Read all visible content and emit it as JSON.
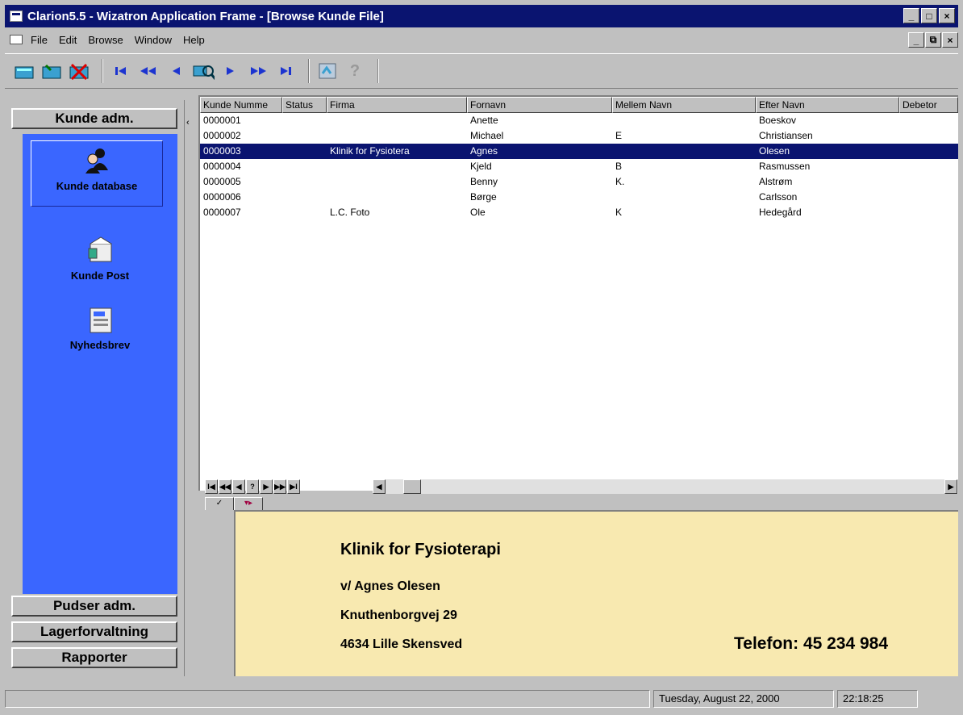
{
  "window": {
    "title": "Clarion5.5 - Wizatron Application Frame - [Browse Kunde File]",
    "controls": [
      "_",
      "□",
      "×"
    ],
    "mdi_controls": [
      "_",
      "⧉",
      "×"
    ]
  },
  "menu": {
    "items": [
      "File",
      "Edit",
      "Browse",
      "Window",
      "Help"
    ]
  },
  "toolbar": {
    "buttons": [
      {
        "name": "insert-record-icon",
        "glyph": "▤"
      },
      {
        "name": "change-record-icon",
        "glyph": "▤"
      },
      {
        "name": "delete-record-icon",
        "glyph": "✕"
      },
      {
        "name": "first-record-icon",
        "glyph": "⏮"
      },
      {
        "name": "previous-page-icon",
        "glyph": "◀◀"
      },
      {
        "name": "previous-record-icon",
        "glyph": "◀"
      },
      {
        "name": "locate-icon",
        "glyph": "🔍"
      },
      {
        "name": "next-record-icon",
        "glyph": "▶"
      },
      {
        "name": "next-page-icon",
        "glyph": "▶▶"
      },
      {
        "name": "last-record-icon",
        "glyph": "⏭"
      },
      {
        "name": "history-icon",
        "glyph": "▣"
      },
      {
        "name": "help-icon",
        "glyph": "?"
      }
    ]
  },
  "sidebar": {
    "groups_top": [
      "Kunde adm."
    ],
    "items": [
      {
        "label": "Kunde database",
        "icon": "people-icon",
        "selected": true
      },
      {
        "label": "Kunde Post",
        "icon": "mail-icon",
        "selected": false
      },
      {
        "label": "Nyhedsbrev",
        "icon": "newsletter-icon",
        "selected": false
      }
    ],
    "groups_bottom": [
      "Pudser adm.",
      "Lagerforvaltning",
      "Rapporter"
    ]
  },
  "browse": {
    "columns": [
      "Kunde Numme",
      "Status",
      "Firma",
      "Fornavn",
      "Mellem Navn",
      "Efter Navn",
      "Debetor"
    ],
    "rows": [
      [
        "0000001",
        "",
        "",
        "Anette",
        "",
        "Boeskov",
        ""
      ],
      [
        "0000002",
        "",
        "",
        "Michael",
        "E",
        "Christiansen",
        ""
      ],
      [
        "0000003",
        "",
        "Klinik for Fysiotera",
        "Agnes",
        "",
        "Olesen",
        ""
      ],
      [
        "0000004",
        "",
        "",
        "Kjeld",
        "B",
        "Rasmussen",
        ""
      ],
      [
        "0000005",
        "",
        "",
        "Benny",
        "K.",
        "Alstrøm",
        ""
      ],
      [
        "0000006",
        "",
        "",
        "Børge",
        "",
        "Carlsson",
        ""
      ],
      [
        "0000007",
        "",
        "L.C. Foto",
        "Ole",
        "K",
        "Hedegård",
        ""
      ]
    ],
    "selected_row": 2,
    "nav_buttons": [
      "I◀",
      "◀◀",
      "◀",
      "?",
      "▶",
      "▶▶",
      "▶I"
    ],
    "tabs": [
      "✓",
      "▾▸"
    ]
  },
  "detail": {
    "company": "Klinik for Fysioterapi",
    "contact": "v/ Agnes Olesen",
    "street": "Knuthenborgvej 29",
    "city": "4634  Lille Skensved",
    "phone": "Telefon: 45 234 984"
  },
  "status": {
    "date": "Tuesday, August 22, 2000",
    "time": "22:18:25"
  },
  "colors": {
    "title_bar": "#0a1470",
    "sidebar_panel": "#3a66ff",
    "detail_background": "#f8e9b0",
    "selection": "#0a1470"
  }
}
